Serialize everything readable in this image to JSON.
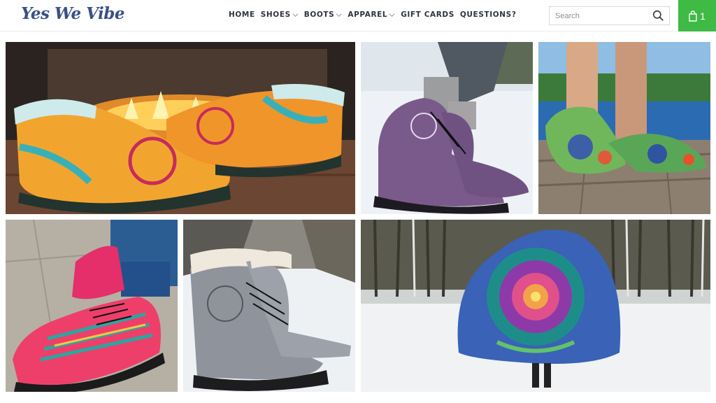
{
  "brand": {
    "logo_text": "Yes We Vibe"
  },
  "nav": {
    "items": [
      {
        "label": "HOME",
        "has_dropdown": false
      },
      {
        "label": "SHOES",
        "has_dropdown": true
      },
      {
        "label": "BOOTS",
        "has_dropdown": true
      },
      {
        "label": "APPAREL",
        "has_dropdown": true
      },
      {
        "label": "GIFT CARDS",
        "has_dropdown": false
      },
      {
        "label": "QUESTIONS?",
        "has_dropdown": false
      }
    ]
  },
  "search": {
    "placeholder": "Search",
    "value": ""
  },
  "cart": {
    "count": "1"
  },
  "colors": {
    "accent_green": "#3fba45",
    "logo_blue": "#3b4f86",
    "nav_text": "#2f3441"
  },
  "tiles": [
    {
      "name": "fireplace-mandala-slippers-image"
    },
    {
      "name": "purple-moon-dreamcatcher-boots-image"
    },
    {
      "name": "floral-water-shoes-image"
    },
    {
      "name": "aztec-pink-sneakers-image"
    },
    {
      "name": "gray-wolf-winter-boots-image"
    },
    {
      "name": "mandala-hooded-blanket-image"
    }
  ]
}
